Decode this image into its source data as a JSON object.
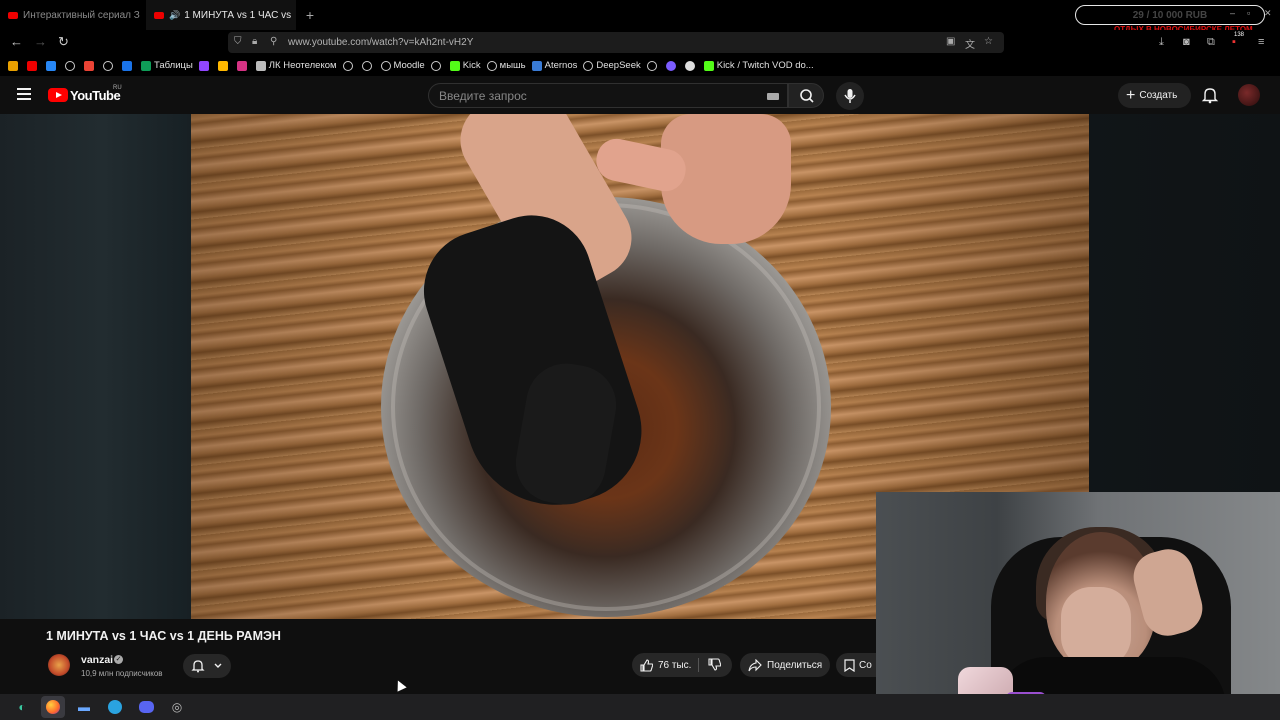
{
  "browser": {
    "tabs": [
      {
        "title": "Интерактивный сериал З",
        "active": false
      },
      {
        "title": "1 МИНУТА vs 1 ЧАС vs",
        "active": true,
        "audio": true
      }
    ],
    "new_tab_symbol": "+",
    "url": "www.youtube.com/watch?v=kAh2nt-vH2Y",
    "donation_goal": "29 / 10 000 RUB",
    "donation_caption": "ОТДЫХ В НОВОСИБИРСКЕ ЛЕТОМ",
    "extension_badge": "138",
    "bookmarks": [
      {
        "label": "Таблицы",
        "icon": "sheets-icon"
      },
      {
        "label": "ЛК Неотелеком",
        "icon": "neotelecom-icon"
      },
      {
        "label": "Moodle",
        "icon": "globe-icon"
      },
      {
        "label": "Kick",
        "icon": "kick-icon"
      },
      {
        "label": "мышь",
        "icon": "globe-icon"
      },
      {
        "label": "Aternos",
        "icon": "aternos-icon"
      },
      {
        "label": "DeepSeek",
        "icon": "globe-icon"
      },
      {
        "label": "Kick / Twitch VOD do...",
        "icon": "kick-icon"
      }
    ]
  },
  "youtube": {
    "logo_text": "YouTube",
    "region": "RU",
    "search_placeholder": "Введите запрос",
    "create_label": "Создать"
  },
  "video": {
    "title": "1 МИНУТА vs 1 ЧАС vs 1 ДЕНЬ РАМЭН",
    "channel_name": "vanzai",
    "subscribers": "10,9 млн подписчиков",
    "likes": "76 тыс.",
    "share_label": "Поделиться",
    "save_label_partial": "Со"
  },
  "colors": {
    "youtube_red": "#ff0000",
    "background": "#0f0f0f",
    "button_bg": "#272727"
  }
}
